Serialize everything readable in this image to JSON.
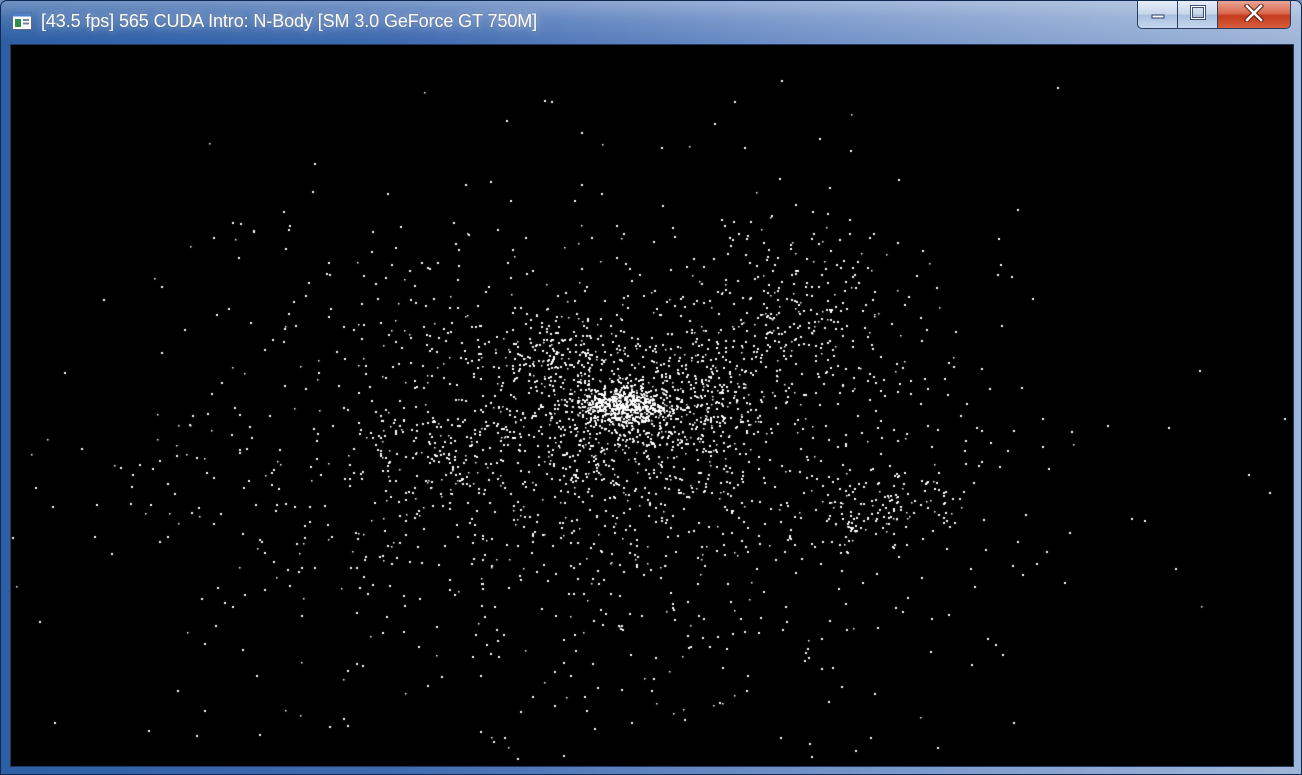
{
  "window": {
    "title": "[43.5 fps] 565 CUDA Intro: N-Body [SM 3.0 GeForce GT 750M]",
    "icon": "application-icon",
    "buttons": [
      {
        "name": "minimize-button",
        "icon": "minimize-icon"
      },
      {
        "name": "maximize-button",
        "icon": "maximize-icon"
      },
      {
        "name": "close-button",
        "icon": "close-icon"
      }
    ]
  },
  "render": {
    "background_color": "#000000",
    "particle_color": "#ffffff"
  },
  "colors": {
    "titlebar_accent": "#2d5fa5",
    "close_button": "#c53a1c"
  }
}
